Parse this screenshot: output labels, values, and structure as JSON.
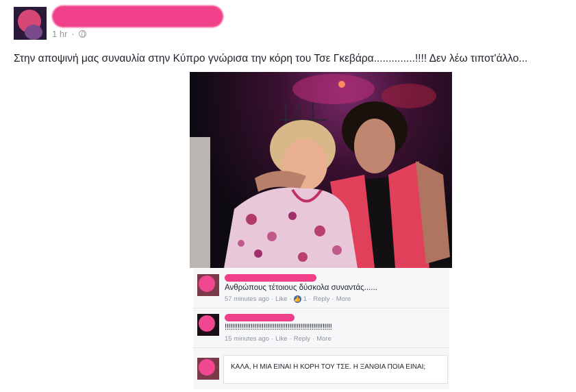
{
  "post": {
    "time": "1 hr",
    "privacy_icon": "globe-icon",
    "text": "Στην αποψινή μας συναυλία στην Κύπρο γνώρισα την κόρη του Τσε Γκεβάρα..............!!!! Δεν λέω τιποτ'άλλο..."
  },
  "comments": [
    {
      "text": "Ανθρώπους τέτοιους δύσκολα συναντάς......",
      "time": "57 minutes ago",
      "like": "Like",
      "like_count": "1",
      "reply": "Reply",
      "more": "More"
    },
    {
      "text": "!!!!!!!!!!!!!!!!!!!!!!!!!!!!!!!!!!!!!!!!!!!!!!!!!!!!!!!!!!",
      "time": "15 minutes ago",
      "like": "Like",
      "reply": "Reply",
      "more": "More"
    }
  ],
  "reply_input": {
    "value": "ΚΑΛΑ, Η ΜΙΑ ΕΙΝΑΙ Η ΚΟΡΗ ΤΟΥ ΤΣΕ. Η ΞΑΝΘΙΑ ΠΟΙΑ ΕΙΝΑΙ;"
  },
  "colors": {
    "redaction": "#f0408a",
    "meta_text": "#90949c",
    "like_blue": "#4267b2"
  }
}
